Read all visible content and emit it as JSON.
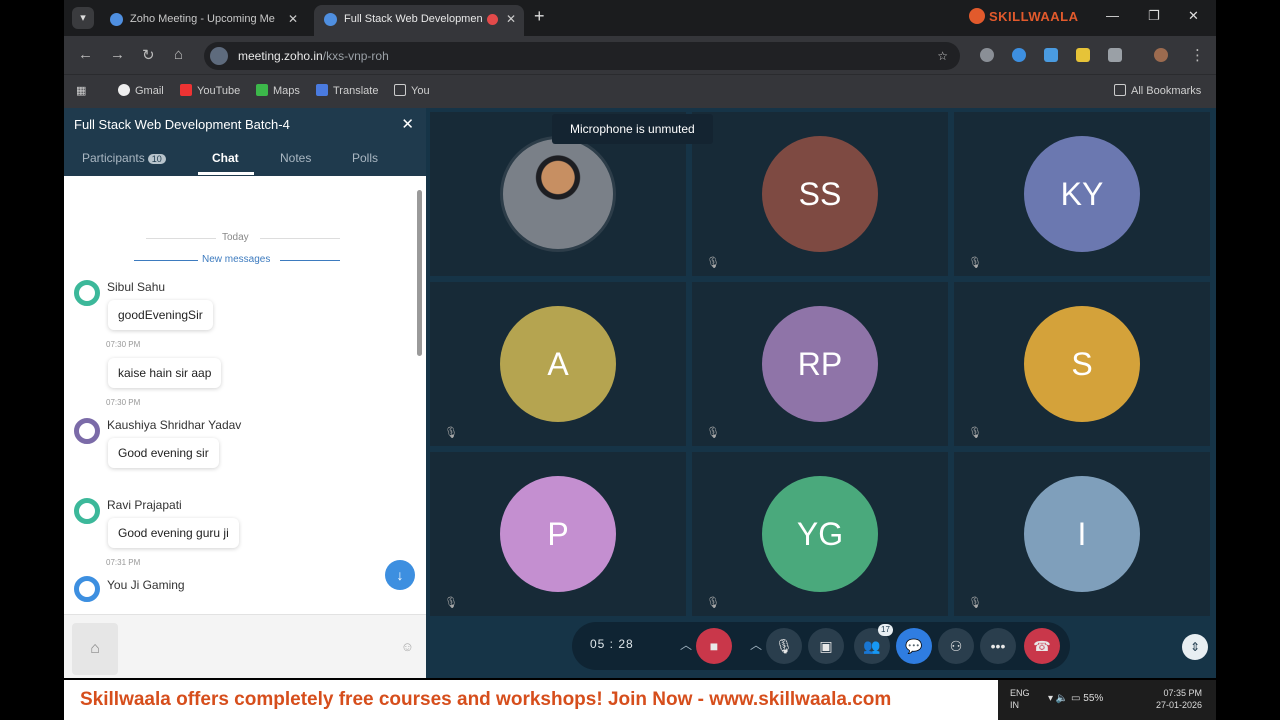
{
  "browser": {
    "tabs": [
      {
        "title": "Zoho Meeting - Upcoming Me"
      },
      {
        "title": "Full Stack Web Developmen"
      }
    ],
    "brand": "SKILLWAALA",
    "url_host": "meeting.zoho.in",
    "url_path": "/kxs-vnp-roh",
    "bookmarks": [
      "Gmail",
      "YouTube",
      "Maps",
      "Translate",
      "You"
    ],
    "all_bookmarks": "All Bookmarks"
  },
  "sidebar": {
    "title": "Full Stack Web Development Batch-4",
    "tabs": {
      "participants": "Participants",
      "participants_count": "10",
      "chat": "Chat",
      "notes": "Notes",
      "polls": "Polls"
    },
    "day_label": "Today",
    "new_messages": "New messages",
    "messages": [
      {
        "sender": "Sibul Sahu",
        "text": "goodEveningSir",
        "time": "07:30 PM",
        "color": "#3cb89a"
      },
      {
        "text": "kaise hain sir aap",
        "time": "07:30 PM"
      },
      {
        "sender": "Kaushiya Shridhar Yadav",
        "text": "Good evening sir",
        "color": "#7b6ba8"
      },
      {
        "sender": "Ravi Prajapati",
        "text": "Good evening guru ji",
        "time": "07:31 PM",
        "color": "#3cb89a"
      },
      {
        "sender": "You Ji Gaming",
        "color": "#3d8fe0"
      }
    ]
  },
  "meeting": {
    "tooltip": "Microphone is unmuted",
    "tiles": [
      {
        "initials": "",
        "color": ""
      },
      {
        "initials": "SS",
        "color": "#7e4a42"
      },
      {
        "initials": "KY",
        "color": "#6b78b0"
      },
      {
        "initials": "A",
        "color": "#b5a450"
      },
      {
        "initials": "RP",
        "color": "#8f74a8"
      },
      {
        "initials": "S",
        "color": "#d4a23a"
      },
      {
        "initials": "P",
        "color": "#c48fd0"
      },
      {
        "initials": "YG",
        "color": "#4aa97c"
      },
      {
        "initials": "I",
        "color": "#7f9fbb"
      }
    ],
    "timer": "05 : 28",
    "participants_badge": "17"
  },
  "banner": "Skillwaala offers completely free courses and workshops! Join Now  - www.skillwaala.com",
  "taskbar": {
    "lang1": "ENG",
    "lang2": "IN",
    "battery": "55%",
    "time": "07:35 PM",
    "date": "27-01-2026"
  }
}
